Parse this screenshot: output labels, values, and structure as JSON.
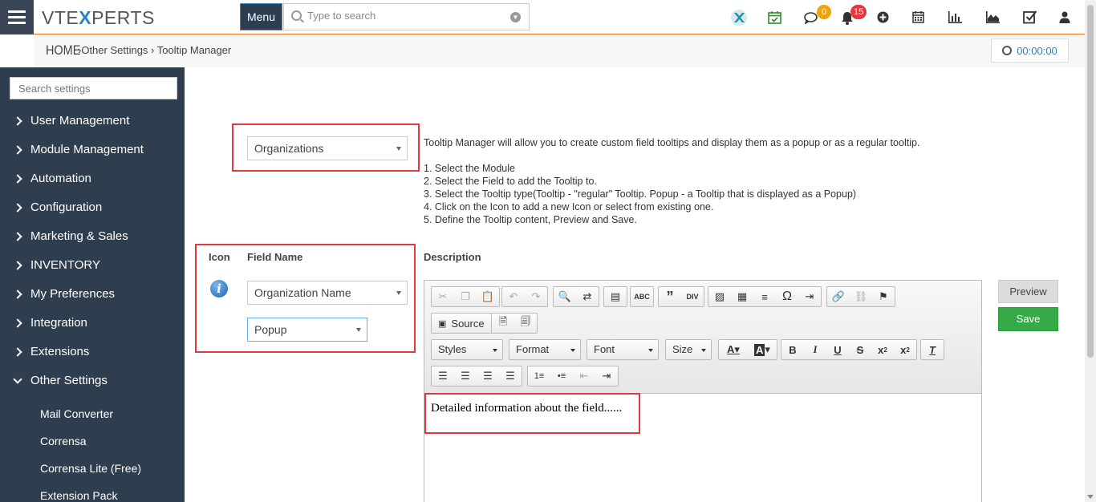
{
  "header": {
    "logo_left": "VTE",
    "logo_x": "X",
    "logo_right": "PERTS",
    "menu_label": "Menu",
    "search_placeholder": "Type to search",
    "chat_badge": "0",
    "notif_badge": "15"
  },
  "breadcrumb": {
    "home": "HOME",
    "trail": "›Other Settings › Tooltip Manager"
  },
  "timer": "00:00:00",
  "sidebar": {
    "search_placeholder": "Search settings",
    "items": [
      {
        "label": "User Management"
      },
      {
        "label": "Module Management"
      },
      {
        "label": "Automation"
      },
      {
        "label": "Configuration"
      },
      {
        "label": "Marketing & Sales"
      },
      {
        "label": "INVENTORY"
      },
      {
        "label": "My Preferences"
      },
      {
        "label": "Integration"
      },
      {
        "label": "Extensions"
      },
      {
        "label": "Other Settings"
      }
    ],
    "subitems": [
      {
        "label": "Mail Converter"
      },
      {
        "label": "Corrensa"
      },
      {
        "label": "Corrensa Lite (Free)"
      },
      {
        "label": "Extension Pack"
      }
    ]
  },
  "module_select": "Organizations",
  "intro": {
    "line0": "Tooltip Manager will allow you to create custom field tooltips and display them as a popup or as a regular tooltip.",
    "steps": [
      "1. Select the Module",
      "2. Select the Field to add the Tooltip to.",
      "3. Select the Tooltip type(Tooltip - \"regular\" Tooltip. Popup - a Tooltip that is displayed as a Popup)",
      "4. Click on the Icon to add a new Icon or select from existing one.",
      "5. Define the Tooltip content, Preview and Save."
    ]
  },
  "form": {
    "icon_label": "Icon",
    "field_label": "Field Name",
    "description_label": "Description",
    "field_select": "Organization Name",
    "type_select": "Popup"
  },
  "editor": {
    "source_label": "Source",
    "styles": "Styles",
    "format": "Format",
    "font": "Font",
    "size": "Size",
    "content": "Detailed information about the field......"
  },
  "buttons": {
    "preview": "Preview",
    "save": "Save"
  },
  "colors": {
    "sidebar_bg": "#2f3e4e",
    "accent_orange": "#e8711c",
    "highlight_red": "#e0393e",
    "save_green": "#35aa47",
    "link_blue": "#2b7fc2"
  }
}
